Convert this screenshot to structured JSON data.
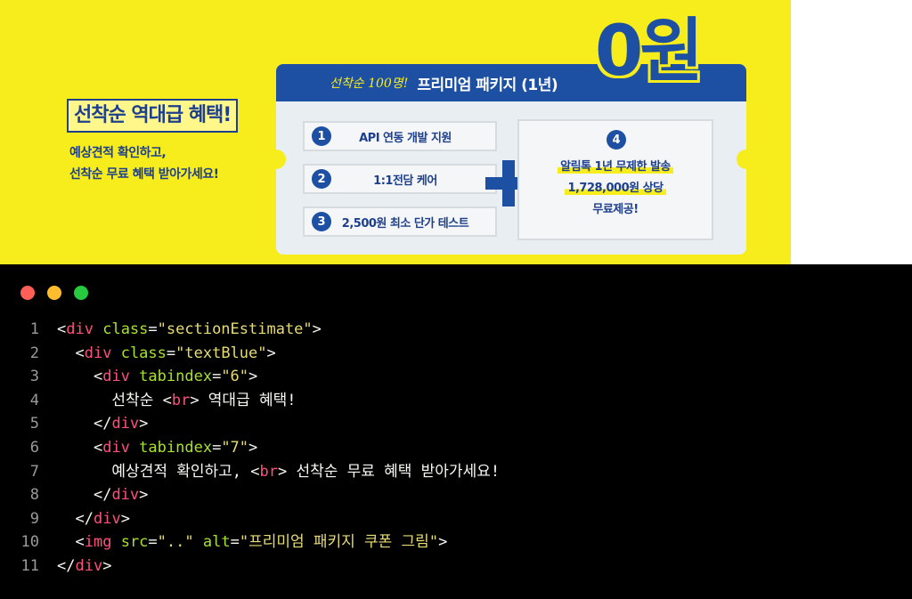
{
  "banner": {
    "headline": "선착순 역대급 혜택!",
    "subtext_line1": "예상견적 확인하고,",
    "subtext_line2": "선착순 무료 혜택 받아가세요!",
    "coupon_tag": "선착순 100명!",
    "coupon_title": "프리미엄 패키지 (1년)",
    "price": "0원",
    "features": [
      {
        "num": "1",
        "label": "API 연동 개발 지원"
      },
      {
        "num": "2",
        "label": "1:1전담 케어"
      },
      {
        "num": "3",
        "label": "2,500원 최소 단가 테스트"
      }
    ],
    "bonus": {
      "num": "4",
      "line1": "알림톡 1년 무제한 발송",
      "line2": "1,728,000원 상당",
      "line3": "무료제공!"
    },
    "colors": {
      "yellow": "#f7ec1c",
      "blue": "#1d4fa3",
      "navy": "#1d3f8c"
    }
  },
  "editor": {
    "window_dots": [
      "red",
      "yellow",
      "green"
    ],
    "line_numbers": [
      "1",
      "2",
      "3",
      "4",
      "5",
      "6",
      "7",
      "8",
      "9",
      "10",
      "11"
    ],
    "code": {
      "l1_tag": "div",
      "l1_attr": "class",
      "l1_val": "\"sectionEstimate\"",
      "l2_tag": "div",
      "l2_attr": "class",
      "l2_val": "\"textBlue\"",
      "l3_tag": "div",
      "l3_attr": "tabindex",
      "l3_val": "\"6\"",
      "l4_text1": "선착순 ",
      "l4_tag": "br",
      "l4_text2": " 역대급 혜택!",
      "l5_tag": "div",
      "l6_tag": "div",
      "l6_attr": "tabindex",
      "l6_val": "\"7\"",
      "l7_text1": "예상견적 확인하고, ",
      "l7_tag": "br",
      "l7_text2": " 선착순 무료 혜택 받아가세요!",
      "l8_tag": "div",
      "l9_tag": "div",
      "l10_tag": "img",
      "l10_attr1": "src",
      "l10_val1": "\"..\"",
      "l10_attr2": "alt",
      "l10_val2": "\"프리미엄 패키지 쿠폰 그림\"",
      "l11_tag": "div"
    }
  }
}
